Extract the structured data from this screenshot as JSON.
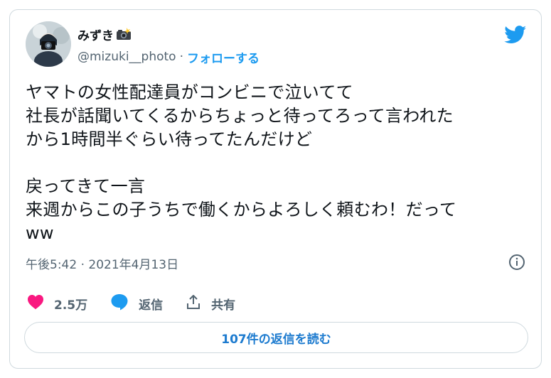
{
  "author": {
    "display_name": "みずき",
    "handle": "@mizuki__photo",
    "separator": "·",
    "follow_label": "フォローする"
  },
  "tweet": {
    "text": "ヤマトの女性配達員がコンビニで泣いてて\n社長が話聞いてくるからちょっと待ってろって言われた\nから1時間半ぐらい待ってたんだけど\n\n戻ってきて一言\n来週からこの子うちで働くからよろしく頼むわ！だって\nww",
    "timestamp": "午後5:42 · 2021年4月13日"
  },
  "actions": {
    "like_count": "2.5万",
    "reply_label": "返信",
    "share_label": "共有"
  },
  "replies_button_label": "107件の返信を読む",
  "colors": {
    "accent": "#1d9bf0",
    "like": "#f91880",
    "text": "#0f1419",
    "secondary": "#536471",
    "border": "#cfd9de"
  }
}
